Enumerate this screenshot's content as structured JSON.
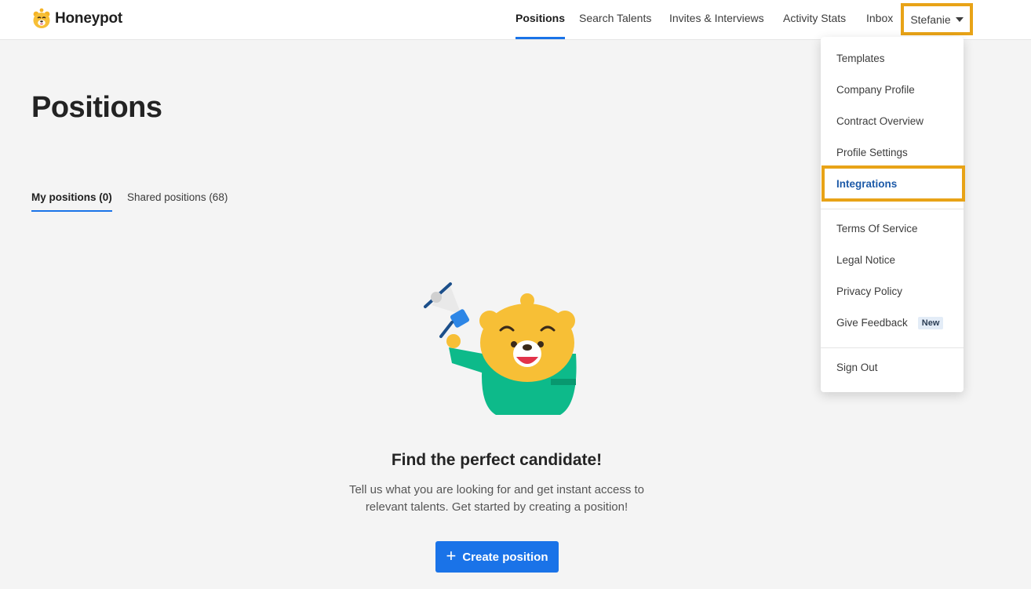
{
  "brand": {
    "name": "Honeypot",
    "logo_icon": "bear-logo-icon",
    "accent": "#1a73e8",
    "highlight": "#e8a317"
  },
  "nav": {
    "items": [
      {
        "label": "Positions",
        "active": true
      },
      {
        "label": "Search Talents"
      },
      {
        "label": "Invites & Interviews"
      },
      {
        "label": "Activity Stats"
      },
      {
        "label": "Inbox"
      }
    ],
    "user": {
      "label": "Stefanie",
      "icon": "chevron-down-icon"
    }
  },
  "page": {
    "title": "Positions"
  },
  "tabs": [
    {
      "label": "My positions (0)",
      "active": true
    },
    {
      "label": "Shared positions (68)"
    }
  ],
  "empty_state": {
    "illustration": "bear-megaphone-illustration",
    "title": "Find the perfect candidate!",
    "description": "Tell us what you are looking for and get instant access to relevant talents. Get started by creating a position!",
    "button_label": "Create position",
    "button_icon": "plus-icon"
  },
  "dropdown": {
    "items": [
      {
        "label": "Templates"
      },
      {
        "label": "Company Profile"
      },
      {
        "label": "Contract Overview"
      },
      {
        "label": "Profile Settings"
      },
      {
        "label": "Integrations",
        "highlighted": true
      },
      {
        "label": "Terms Of Service"
      },
      {
        "label": "Legal Notice"
      },
      {
        "label": "Privacy Policy"
      },
      {
        "label": "Give Feedback",
        "badge": "New"
      },
      {
        "label": "Sign Out"
      }
    ]
  }
}
